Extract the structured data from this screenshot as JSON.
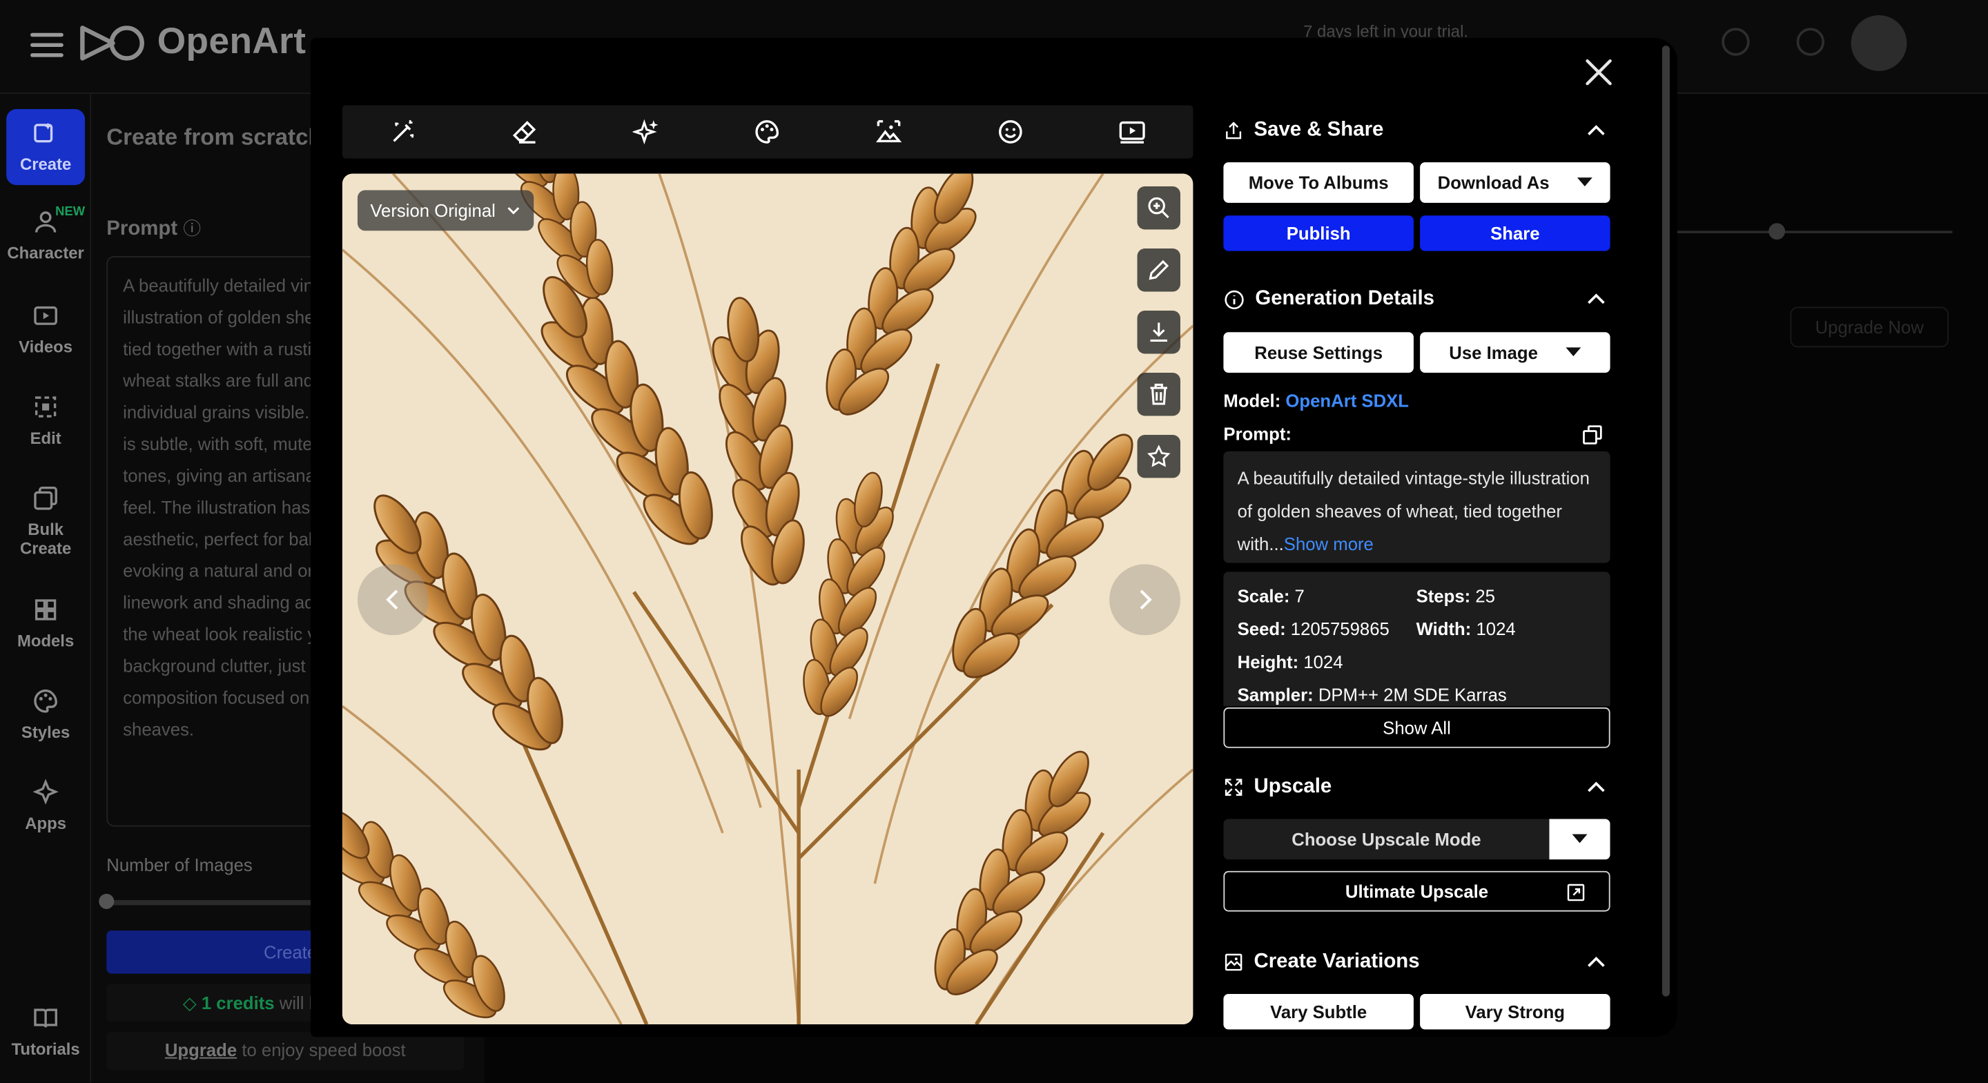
{
  "app": {
    "name": "OpenArt",
    "trial_text": "7 days left in your trial.",
    "sidebar": [
      {
        "label": "Create",
        "icon": "create-icon",
        "active": true
      },
      {
        "label": "Character",
        "icon": "character-icon",
        "badge": "NEW"
      },
      {
        "label": "Videos",
        "icon": "video-icon"
      },
      {
        "label": "Edit",
        "icon": "edit-icon"
      },
      {
        "label": "Bulk Create",
        "icon": "bulk-create-icon"
      },
      {
        "label": "Models",
        "icon": "models-icon"
      },
      {
        "label": "Styles",
        "icon": "styles-icon"
      },
      {
        "label": "Apps",
        "icon": "apps-icon"
      },
      {
        "label": "Tutorials",
        "icon": "tutorials-icon"
      }
    ],
    "panel": {
      "title": "Create from scratch",
      "prompt_label": "Prompt",
      "prompt_text": "A beautifully detailed vintage-style illustration of golden sheaves of wheat, tied together with a rustic twine. The wheat stalks are full and ripe, with individual grains visible. The background is subtle, with soft, muted and warm earth tones, giving an artisanal, handcrafted feel. The illustration has a classic aesthetic, perfect for bakery packaging, evoking a natural and organic look. Fine linework and shading add depth, making the wheat look realistic yet elegant. No background clutter, just a refined composition focused on the wheat sheaves.",
      "num_images_label": "Number of Images",
      "create_label": "Create",
      "credits_text": "1 credits",
      "credits_suffix": "will be charged",
      "upgrade_link": "Upgrade",
      "upgrade_suffix": "to enjoy speed boost"
    },
    "bg_upgrade_now": "Upgrade Now"
  },
  "modal": {
    "version_label": "Version Original",
    "toolbar_icons": [
      "magic-wand-icon",
      "eraser-icon",
      "sparkle-icon",
      "palette-icon",
      "image-expand-icon",
      "face-icon",
      "video-play-icon"
    ],
    "side_tools": [
      "zoom-in-icon",
      "pencil-icon",
      "download-icon",
      "trash-icon",
      "star-icon"
    ],
    "save_share": {
      "title": "Save & Share",
      "move_to_albums": "Move To Albums",
      "download_as": "Download As",
      "publish": "Publish",
      "share": "Share"
    },
    "generation": {
      "title": "Generation Details",
      "reuse_settings": "Reuse Settings",
      "use_image": "Use Image",
      "model_label": "Model:",
      "model_value": "OpenArt SDXL",
      "prompt_label": "Prompt:",
      "prompt_preview": "A beautifully detailed vintage-style illustration of golden sheaves of wheat, tied together with...",
      "show_more": "Show more",
      "scale_label": "Scale:",
      "scale_value": "7",
      "steps_label": "Steps:",
      "steps_value": "25",
      "seed_label": "Seed:",
      "seed_value": "1205759865",
      "width_label": "Width:",
      "width_value": "1024",
      "height_label": "Height:",
      "height_value": "1024",
      "sampler_label": "Sampler:",
      "sampler_value": "DPM++ 2M SDE Karras",
      "show_all": "Show All"
    },
    "upscale": {
      "title": "Upscale",
      "choose_mode": "Choose Upscale Mode",
      "ultimate": "Ultimate Upscale"
    },
    "variations": {
      "title": "Create Variations",
      "vary_subtle": "Vary Subtle",
      "vary_strong": "Vary Strong"
    }
  },
  "colors": {
    "accent_blue": "#0b22f0",
    "link_blue": "#3f8cff",
    "card_bg": "#1d1d1d",
    "credit_green": "#158a4d"
  }
}
